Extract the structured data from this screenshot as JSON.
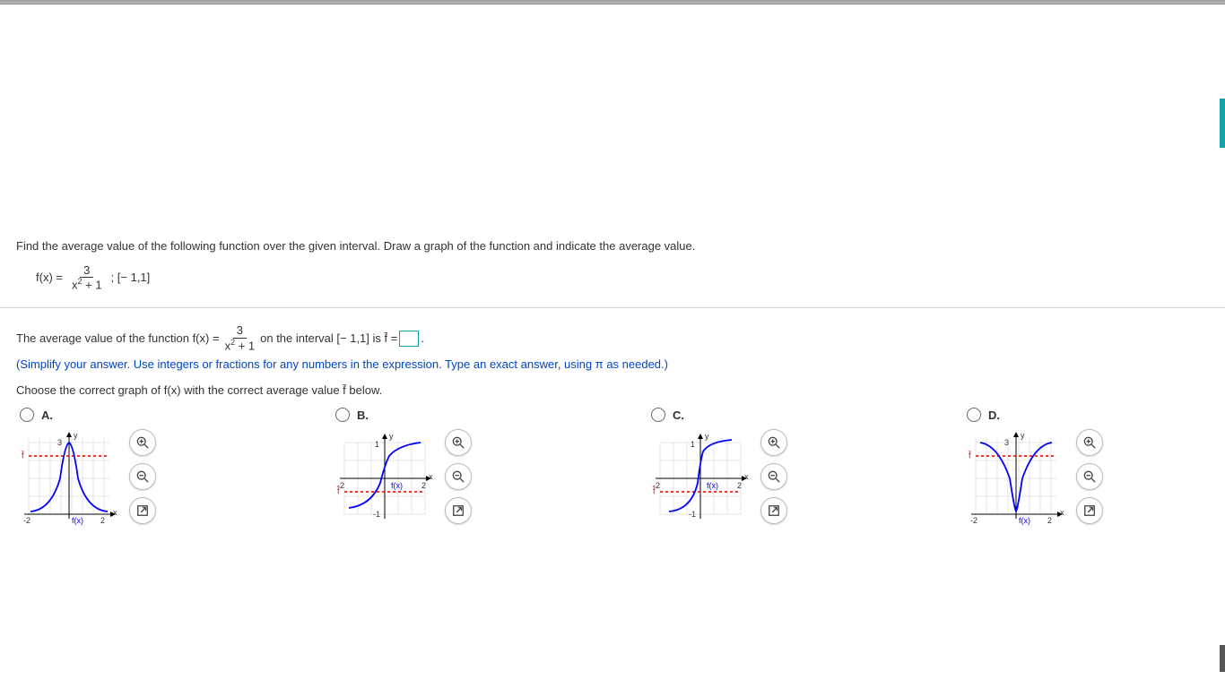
{
  "question": {
    "intro": "Find the average value of the following function over the given interval. Draw a graph of the function and indicate the average value.",
    "fx_label": "f(x) =",
    "numerator": "3",
    "denominator_pre": "x",
    "denominator_exp": "2",
    "denominator_post": " + 1",
    "interval": "; [− 1,1]"
  },
  "answer_line": {
    "pre": "The average value of the function f(x) = ",
    "mid": " on the interval [− 1,1] is f̄ = ",
    "post": "."
  },
  "instruction": "(Simplify your answer. Use integers or fractions for any numbers in the expression. Type an exact answer, using π as needed.)",
  "graph_prompt": "Choose the correct graph of f(x) with the correct average value f̄ below.",
  "choices": [
    {
      "label": "A.",
      "y_label": "y",
      "x_label": "x",
      "fx": "f(x)",
      "fbar": "f̄",
      "xmin": "-2",
      "xmax": "2",
      "ytick": "3"
    },
    {
      "label": "B.",
      "y_label": "y",
      "x_label": "x",
      "fx": "f(x)",
      "fbar": "f̄",
      "xmin": "-2",
      "xmax": "2",
      "ytick": "1",
      "ybot": "-1"
    },
    {
      "label": "C.",
      "y_label": "y",
      "x_label": "x",
      "fx": "f(x)",
      "fbar": "f̄",
      "xmin": "-2",
      "xmax": "2",
      "ytick": "1",
      "ybot": "-1"
    },
    {
      "label": "D.",
      "y_label": "y",
      "x_label": "x",
      "fx": "f(x)",
      "fbar": "f̄",
      "xmin": "-2",
      "xmax": "2",
      "ytick": "3"
    }
  ],
  "chart_data": [
    {
      "type": "line",
      "title": "Choice A",
      "xlim": [
        -2,
        2
      ],
      "ylim": [
        0,
        3
      ],
      "curve": "bell_up",
      "peak": 3,
      "fbar_y": 2.4,
      "fbar_style": "dashed-red",
      "curve_color": "blue"
    },
    {
      "type": "line",
      "title": "Choice B",
      "xlim": [
        -2,
        2
      ],
      "ylim": [
        -1,
        1
      ],
      "curve": "s_curve",
      "fbar_y": -0.5,
      "fbar_style": "dashed-red",
      "curve_color": "blue"
    },
    {
      "type": "line",
      "title": "Choice C",
      "xlim": [
        -2,
        2
      ],
      "ylim": [
        -1,
        1
      ],
      "curve": "s_curve_steep",
      "fbar_y": -0.5,
      "fbar_style": "dashed-red",
      "curve_color": "blue"
    },
    {
      "type": "line",
      "title": "Choice D",
      "xlim": [
        -2,
        2
      ],
      "ylim": [
        0,
        3
      ],
      "curve": "v_shape",
      "vertex": 0,
      "top": 3,
      "fbar_y": 2.4,
      "fbar_style": "dashed-red",
      "curve_color": "blue"
    }
  ]
}
